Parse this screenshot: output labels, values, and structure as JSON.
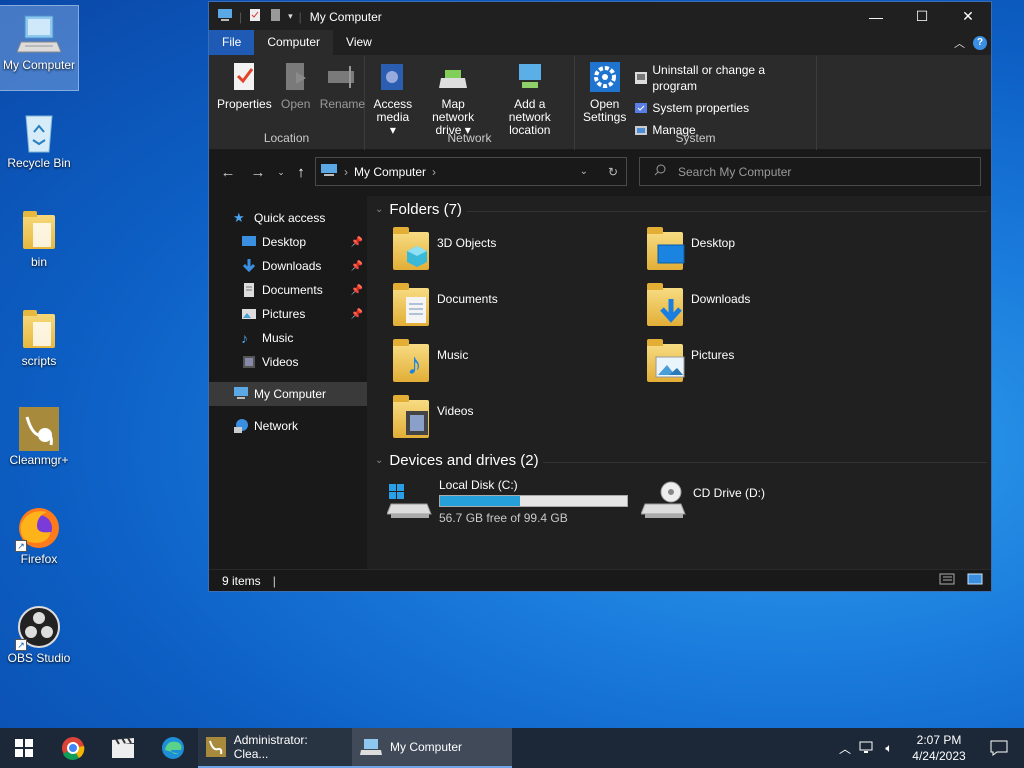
{
  "desktop": {
    "icons": [
      {
        "label": "My Computer",
        "icon": "computer-icon"
      },
      {
        "label": "Recycle Bin",
        "icon": "recycle-bin-icon"
      },
      {
        "label": "bin",
        "icon": "folder-icon"
      },
      {
        "label": "scripts",
        "icon": "folder-icon"
      },
      {
        "label": "Cleanmgr+",
        "icon": "cleanmgr-icon"
      },
      {
        "label": "Firefox",
        "icon": "firefox-icon"
      },
      {
        "label": "OBS Studio",
        "icon": "obs-icon"
      }
    ]
  },
  "window": {
    "title": "My Computer",
    "controls": {
      "minimize": "—",
      "maximize": "☐",
      "close": "✕"
    },
    "tabs": [
      "File",
      "Computer",
      "View"
    ],
    "active_tab": "Computer",
    "ribbon": {
      "groups": [
        {
          "label": "Location",
          "buttons": [
            "Properties",
            "Open",
            "Rename"
          ]
        },
        {
          "label": "Network",
          "buttons": [
            "Access media",
            "Map network drive",
            "Add a network location"
          ]
        },
        {
          "label": "System",
          "big": "Open Settings",
          "smalls": [
            "Uninstall or change a program",
            "System properties",
            "Manage"
          ]
        }
      ],
      "buttons": {
        "properties": "Properties",
        "open": "Open",
        "rename": "Rename",
        "access_media_1": "Access",
        "access_media_2": "media ▾",
        "map_drive_1": "Map network",
        "map_drive_2": "drive ▾",
        "add_location_1": "Add a network",
        "add_location_2": "location",
        "open_settings_1": "Open",
        "open_settings_2": "Settings",
        "uninstall": "Uninstall or change a program",
        "sys_props": "System properties",
        "manage": "Manage"
      },
      "group_labels": {
        "location": "Location",
        "network": "Network",
        "system": "System"
      }
    },
    "address": {
      "path": "My Computer",
      "search_placeholder": "Search My Computer"
    },
    "nav": {
      "quick_access": "Quick access",
      "items": [
        {
          "label": "Desktop",
          "pinned": true
        },
        {
          "label": "Downloads",
          "pinned": true
        },
        {
          "label": "Documents",
          "pinned": true
        },
        {
          "label": "Pictures",
          "pinned": true
        },
        {
          "label": "Music",
          "pinned": false
        },
        {
          "label": "Videos",
          "pinned": false
        }
      ],
      "my_computer": "My Computer",
      "network": "Network"
    },
    "content": {
      "folders_header": "Folders (7)",
      "folders": [
        "3D Objects",
        "Desktop",
        "Documents",
        "Downloads",
        "Music",
        "Pictures",
        "Videos"
      ],
      "drives_header": "Devices and drives (2)",
      "drives": [
        {
          "name": "Local Disk (C:)",
          "free_text": "56.7 GB free of 99.4 GB",
          "used_fraction": 0.43
        },
        {
          "name": "CD Drive (D:)"
        }
      ]
    },
    "status": {
      "items": "9 items"
    }
  },
  "taskbar": {
    "apps": [
      {
        "label": "Administrator: Clea..."
      },
      {
        "label": "My Computer"
      }
    ],
    "time": "2:07 PM",
    "date": "4/24/2023"
  },
  "colors": {
    "accent": "#1f5bb5",
    "drive_bar": "#26a0da",
    "explorer_bg": "#202020"
  }
}
